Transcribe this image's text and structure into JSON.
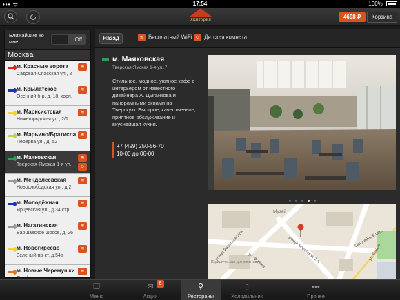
{
  "status": {
    "time": "17:54",
    "battery": "100%"
  },
  "header": {
    "price": "4698 ₽",
    "cart_label": "Корзина",
    "logo_text": "якитория"
  },
  "sidebar": {
    "nearby_label": "Ближайшие ко мне",
    "toggle_state": "Off",
    "city": "Москва",
    "items": [
      {
        "name": "м. Красные ворота",
        "address": "Садовая-Спасская ул., 2",
        "line_color": "#d9231d",
        "wifi": true,
        "kids": false
      },
      {
        "name": "м. Крылатское",
        "address": "Осенний б-р, д. 18, корп.",
        "line_color": "#1937b0",
        "wifi": true,
        "kids": false
      },
      {
        "name": "м. Марксистская",
        "address": "Нижегородская ул., 2/1",
        "line_color": "#f2d32a",
        "wifi": true,
        "kids": false
      },
      {
        "name": "м. Марьино/Братисла",
        "address": "Перерва ул., д. 52",
        "line_color": "#b7d94a",
        "wifi": true,
        "kids": false
      },
      {
        "name": "м. Маяковская",
        "address": "Тверская-Ямская 1-я ул.,",
        "line_color": "#2f9e54",
        "wifi": true,
        "kids": true,
        "active": true
      },
      {
        "name": "м. Менделеевская",
        "address": "Новослободская ул., д.2",
        "line_color": "#999999",
        "wifi": true,
        "kids": false
      },
      {
        "name": "м. Молодёжная",
        "address": "Ярцевская ул., д.34 стр.1",
        "line_color": "#1937b0",
        "wifi": true,
        "kids": false
      },
      {
        "name": "м. Нагатинская",
        "address": "Варшавское шоссе, д. 26",
        "line_color": "#999999",
        "wifi": true,
        "kids": false
      },
      {
        "name": "м. Новогиреево",
        "address": "Зеленый пр-кт, д.54а",
        "line_color": "#f2d32a",
        "wifi": true,
        "kids": false
      },
      {
        "name": "м. Новые Черемушки",
        "address": "Профсоюзная ул., д.",
        "line_color": "#e07a1f",
        "wifi": true,
        "kids": false
      }
    ]
  },
  "main": {
    "back_label": "Назад",
    "feature_wifi": "Бесплатный WiFi",
    "feature_kids": "Детская комната",
    "station": "м. Маяковская",
    "address": "Тверская-Ямская 1-я ул.,7",
    "description": "Стильное, модное, уютное кафе с интерьером от известного дизайнера А. Цыганкова и панорамными окнами на Тверскую. Быстрое, качественное, приятное обслуживание и вкуснейшая кухня.",
    "phone": "+7 (499) 250-56-70",
    "hours": "10-00 до 06-00",
    "photo_page": 4,
    "photo_count": 5,
    "map": {
      "label_museum": "Музей",
      "street_brestskaya": "улица Брестская 1-я",
      "street_vasilievskaya": "улица Васильевская",
      "street_fuchika": "ул. Фучика",
      "street_oruzheiny": "Оружейный пер.",
      "street_sadovaya": "ул. Садов",
      "legal": "Юридическая документация"
    }
  },
  "tabbar": {
    "tabs": [
      {
        "label": "Меню",
        "icon": "menu-book-icon",
        "glyph": "❐"
      },
      {
        "label": "Акции",
        "icon": "gift-icon",
        "glyph": "✉",
        "badge": "6"
      },
      {
        "label": "Рестораны",
        "icon": "location-pin-icon",
        "glyph": "⚲",
        "active": true
      },
      {
        "label": "Холодильник",
        "icon": "fridge-icon",
        "glyph": "▯"
      },
      {
        "label": "Прочее",
        "icon": "more-dots-icon",
        "glyph": "•••"
      }
    ]
  }
}
